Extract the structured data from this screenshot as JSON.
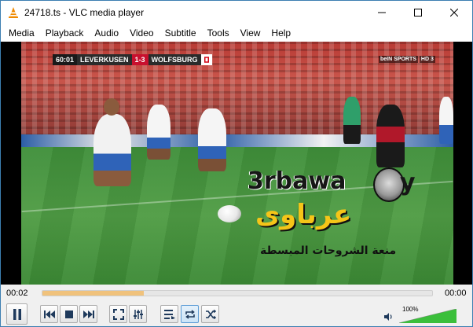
{
  "window": {
    "title": "24718.ts - VLC media player",
    "icon": "vlc-cone-icon",
    "controls": [
      "minimize-icon",
      "maximize-icon",
      "close-icon"
    ]
  },
  "menu": {
    "items": [
      {
        "label": "Media"
      },
      {
        "label": "Playback"
      },
      {
        "label": "Audio"
      },
      {
        "label": "Video"
      },
      {
        "label": "Subtitle"
      },
      {
        "label": "Tools"
      },
      {
        "label": "View"
      },
      {
        "label": "Help"
      }
    ]
  },
  "video": {
    "scoreboard": {
      "clock": "60:01",
      "home_team": "LEVERKUSEN",
      "score": "1-3",
      "away_team": "WOLFSBURG"
    },
    "channel": {
      "name": "beIN SPORTS",
      "hd": "HD 3"
    },
    "watermark": {
      "latin": "3rbawa",
      "latin_suffix": "y",
      "arabic": "عرباوى",
      "subtitle": "منعة الشروحات المبسطة"
    }
  },
  "seek": {
    "elapsed": "00:02",
    "total": "00:00",
    "played_fraction": 0.0,
    "buffered_fraction": 0.26
  },
  "controls": {
    "buttons": [
      {
        "name": "pause-button",
        "icon": "pause-icon"
      },
      {
        "name": "previous-button",
        "icon": "skip-previous-icon"
      },
      {
        "name": "stop-button",
        "icon": "stop-icon"
      },
      {
        "name": "next-button",
        "icon": "skip-next-icon"
      },
      {
        "name": "fullscreen-button",
        "icon": "fullscreen-icon"
      },
      {
        "name": "extended-settings-button",
        "icon": "equalizer-icon"
      },
      {
        "name": "playlist-button",
        "icon": "playlist-icon"
      },
      {
        "name": "loop-button",
        "icon": "loop-icon",
        "active": true
      },
      {
        "name": "shuffle-button",
        "icon": "shuffle-icon"
      }
    ],
    "volume": {
      "label": "100%",
      "level": 1.0,
      "icon": "speaker-icon"
    }
  },
  "colors": {
    "accent_blue": "#1f6fbf",
    "seek_buffer": "#f0c27c",
    "volume_green": "#3bbf3b",
    "watermark_yellow": "#f5c518"
  }
}
